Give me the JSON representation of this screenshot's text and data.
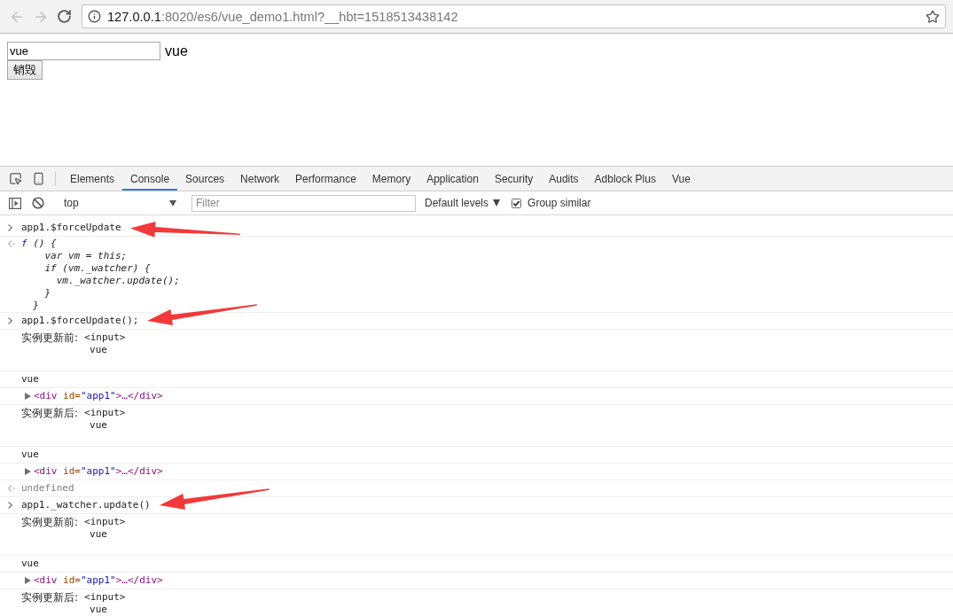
{
  "browser": {
    "back": {
      "disabled": true
    },
    "forward": {
      "disabled": true
    },
    "url": {
      "host": "127.0.0.1",
      "rest": ":8020/es6/vue_demo1.html?__hbt=1518513438142"
    }
  },
  "page": {
    "input_value": "vue",
    "echo": "vue",
    "button": "销毁"
  },
  "devtools": {
    "tabs": [
      {
        "label": "Elements",
        "selected": false
      },
      {
        "label": "Console",
        "selected": true
      },
      {
        "label": "Sources",
        "selected": false
      },
      {
        "label": "Network",
        "selected": false
      },
      {
        "label": "Performance",
        "selected": false
      },
      {
        "label": "Memory",
        "selected": false
      },
      {
        "label": "Application",
        "selected": false
      },
      {
        "label": "Security",
        "selected": false
      },
      {
        "label": "Audits",
        "selected": false
      },
      {
        "label": "Adblock Plus",
        "selected": false
      },
      {
        "label": "Vue",
        "selected": false
      }
    ],
    "toolbar": {
      "context": "top",
      "filter_placeholder": "Filter",
      "levels": "Default levels",
      "group_similar": {
        "label": "Group similar",
        "checked": true
      }
    },
    "messages": [
      {
        "kind": "input",
        "text": "app1.$forceUpdate",
        "annotated": true,
        "arrow_rising": false
      },
      {
        "kind": "function",
        "keyword": "f",
        "lines": [
          " () {",
          "    var vm = this;",
          "    if (vm._watcher) {",
          "      vm._watcher.update();",
          "    }",
          "  }"
        ]
      },
      {
        "kind": "input",
        "text": "app1.$forceUpdate();",
        "annotated": true,
        "arrow_rising": true
      },
      {
        "kind": "log",
        "label": "实例更新前:",
        "element": "<input>",
        "value": "vue"
      },
      {
        "kind": "text",
        "text": "vue"
      },
      {
        "kind": "node",
        "expanded": false,
        "tokens": [
          {
            "kind": "tag",
            "text": "<div"
          },
          {
            "kind": "attr_name",
            "text": " id="
          },
          {
            "kind": "attr_value",
            "text": "\"app1\""
          },
          {
            "kind": "tag",
            "text": ">…</div>"
          }
        ]
      },
      {
        "kind": "log",
        "label": "实例更新后:",
        "element": "<input>",
        "value": "vue"
      },
      {
        "kind": "text",
        "text": "vue"
      },
      {
        "kind": "node",
        "expanded": false,
        "tokens": [
          {
            "kind": "tag",
            "text": "<div"
          },
          {
            "kind": "attr_name",
            "text": " id="
          },
          {
            "kind": "attr_value",
            "text": "\"app1\""
          },
          {
            "kind": "tag",
            "text": ">…</div>"
          }
        ]
      },
      {
        "kind": "result",
        "text": "undefined"
      },
      {
        "kind": "input",
        "text": "app1._watcher.update()",
        "annotated": true,
        "arrow_rising": true
      },
      {
        "kind": "log",
        "label": "实例更新前:",
        "element": "<input>",
        "value": "vue"
      },
      {
        "kind": "text",
        "text": "vue"
      },
      {
        "kind": "node",
        "expanded": false,
        "tokens": [
          {
            "kind": "tag",
            "text": "<div"
          },
          {
            "kind": "attr_name",
            "text": " id="
          },
          {
            "kind": "attr_value",
            "text": "\"app1\""
          },
          {
            "kind": "tag",
            "text": ">…</div>"
          }
        ]
      },
      {
        "kind": "log",
        "label": "实例更新后:",
        "element": "<input>",
        "value": "vue"
      }
    ]
  }
}
